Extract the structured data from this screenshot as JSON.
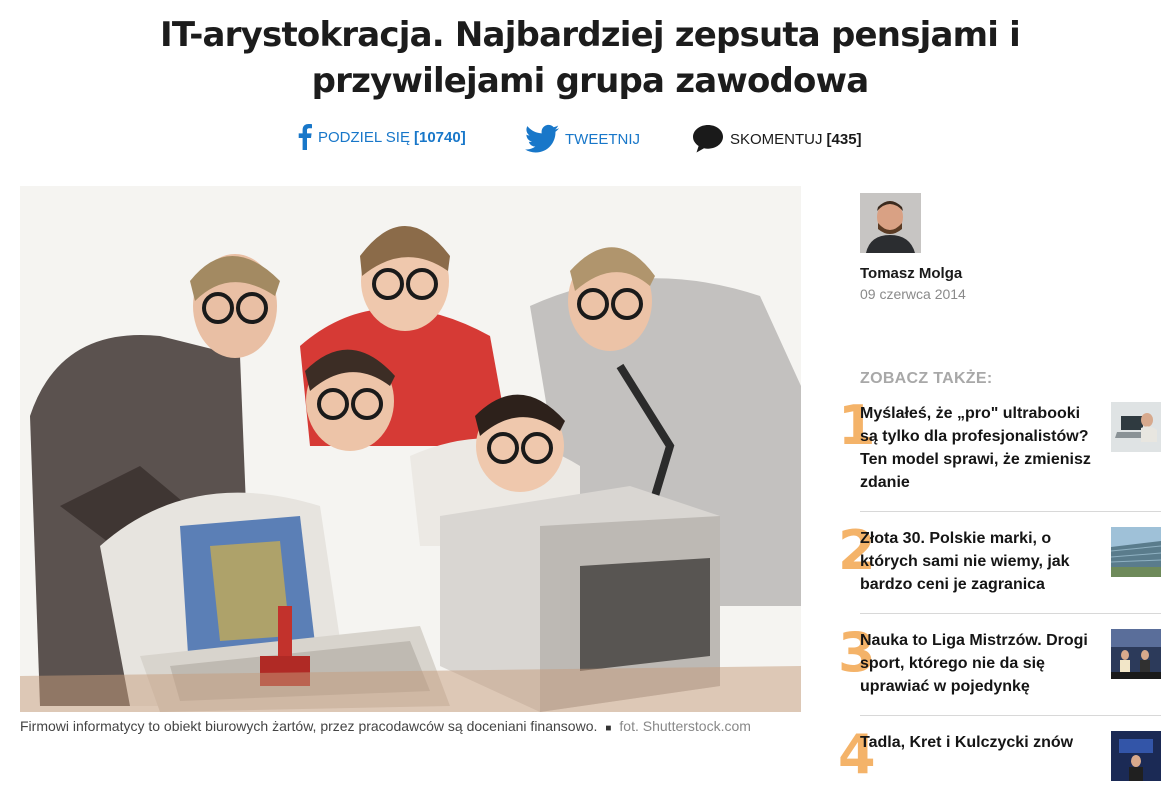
{
  "article": {
    "title": "IT-arystokracja. Najbardziej zepsuta pensjami i przywilejami grupa zawodowa"
  },
  "share": {
    "facebook_label": "PODZIEL SIĘ",
    "facebook_count": "[10740]",
    "twitter_label": "TWEETNIJ",
    "comment_label": "SKOMENTUJ",
    "comment_count": "[435]"
  },
  "photo": {
    "caption": "Firmowi informatycy to obiekt biurowych żartów, przez pracodawców są doceniani finansowo.",
    "separator": "■",
    "credit": "fot. Shutterstock.com"
  },
  "author": {
    "name": "Tomasz Molga",
    "date": "09 czerwca 2014"
  },
  "related": {
    "heading": "ZOBACZ TAKŻE:",
    "items": [
      {
        "num": "1",
        "title": "Myślałeś, że „pro\" ultrabooki są tylko dla profesjonalistów? Ten model sprawi, że zmienisz zdanie"
      },
      {
        "num": "2",
        "title": "Złota 30. Polskie marki, o których sami nie wiemy, jak bardzo ceni je zagranica"
      },
      {
        "num": "3",
        "title": "Nauka to Liga Mistrzów. Drogi sport, którego nie da się uprawiać w pojedynkę"
      },
      {
        "num": "4",
        "title": "Tadla, Kret i Kulczycki znów"
      }
    ]
  },
  "colors": {
    "link_blue": "#1877c9",
    "number_orange": "#f3a64f",
    "muted_gray": "#a8a8a8"
  }
}
